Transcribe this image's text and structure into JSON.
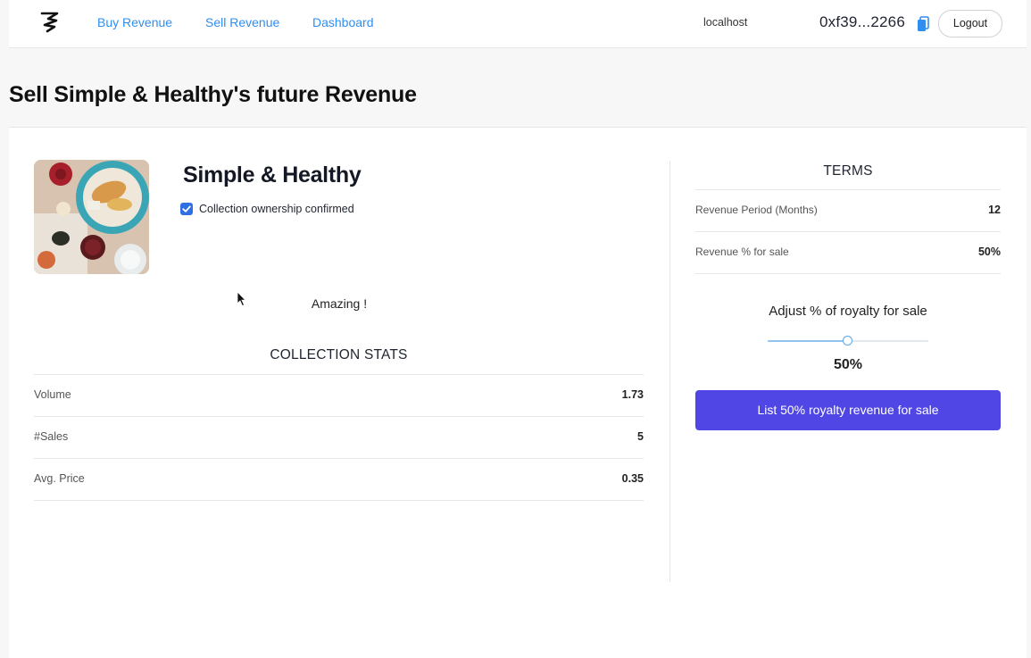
{
  "nav": {
    "links": [
      "Buy Revenue",
      "Sell Revenue",
      "Dashboard"
    ],
    "host": "localhost",
    "wallet": "0xf39...2266",
    "logout_label": "Logout"
  },
  "page": {
    "title": "Sell Simple & Healthy's future Revenue"
  },
  "collection": {
    "name": "Simple & Healthy",
    "ownership_checked": true,
    "ownership_label": "Collection ownership confirmed",
    "description": "Amazing !"
  },
  "stats": {
    "heading": "COLLECTION STATS",
    "rows": [
      {
        "label": "Volume",
        "value": "1.73"
      },
      {
        "label": "#Sales",
        "value": "5"
      },
      {
        "label": "Avg. Price",
        "value": "0.35"
      }
    ]
  },
  "terms": {
    "heading": "TERMS",
    "rows": [
      {
        "label": "Revenue Period (Months)",
        "value": "12"
      },
      {
        "label": "Revenue % for sale",
        "value": "50%"
      }
    ]
  },
  "royalty": {
    "adjust_label": "Adjust % of royalty for sale",
    "value_percent": 50,
    "value_label": "50%",
    "button_label": "List 50% royalty revenue for sale"
  },
  "colors": {
    "accent": "#4f46e5",
    "link": "#2f8ef0",
    "checkbox": "#2f6fe3"
  },
  "icons": {
    "logo": "logo-icon",
    "copy": "copy-icon",
    "cursor": "mouse-cursor-icon"
  }
}
